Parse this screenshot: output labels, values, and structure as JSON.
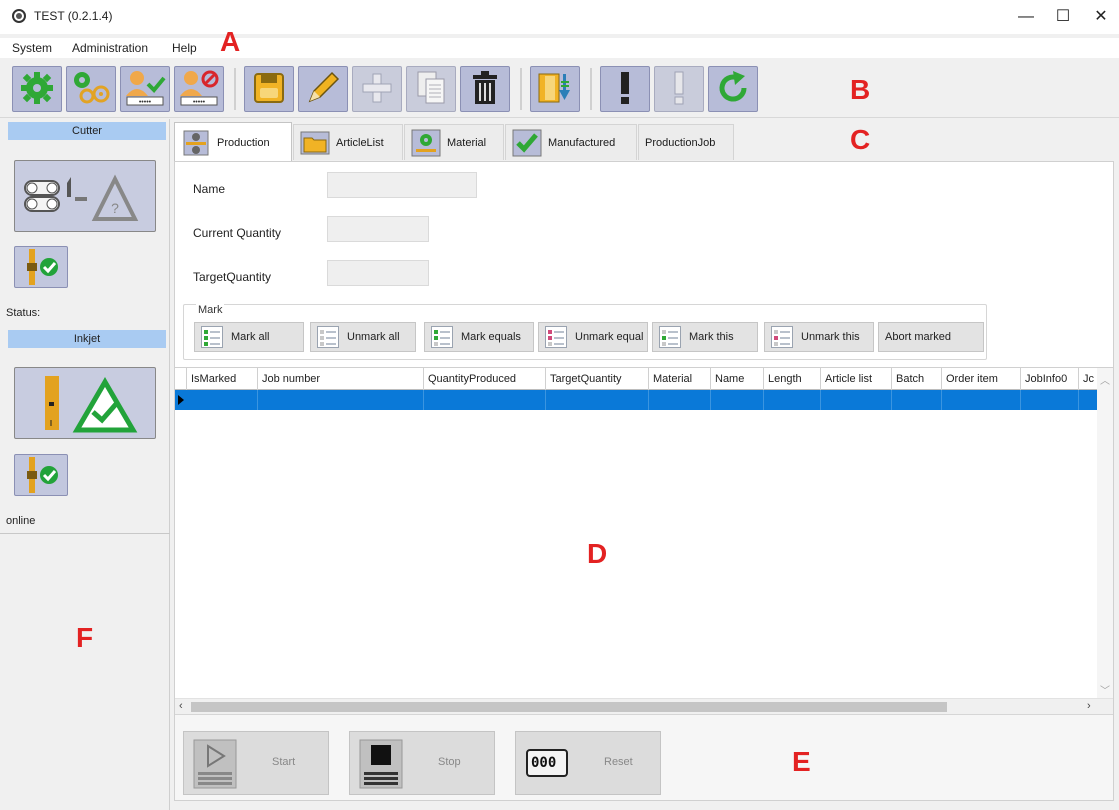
{
  "window": {
    "title": "TEST (0.2.1.4)",
    "controls": {
      "minimize": "—",
      "maximize": "☐",
      "close": "✕"
    }
  },
  "menu": {
    "items": [
      "System",
      "Administration",
      "Help"
    ]
  },
  "annotations": {
    "a": "A",
    "b": "B",
    "c": "C",
    "d": "D",
    "e": "E",
    "f": "F"
  },
  "toolbar": {
    "buttons": [
      {
        "icon": "gear-icon",
        "enabled": true
      },
      {
        "icon": "gears-icon",
        "enabled": true
      },
      {
        "icon": "user-check-icon",
        "enabled": true
      },
      {
        "icon": "user-block-icon",
        "enabled": true
      },
      {
        "icon": "save-icon",
        "enabled": true
      },
      {
        "icon": "pencil-icon",
        "enabled": true
      },
      {
        "icon": "plus-icon",
        "enabled": false
      },
      {
        "icon": "copy-icon",
        "enabled": false
      },
      {
        "icon": "trash-icon",
        "enabled": true
      },
      {
        "icon": "import-icon",
        "enabled": true
      },
      {
        "icon": "exclamation-icon",
        "enabled": true
      },
      {
        "icon": "exclamation-disabled-icon",
        "enabled": false
      },
      {
        "icon": "refresh-icon",
        "enabled": true
      }
    ]
  },
  "left_panel": {
    "cutter": {
      "header": "Cutter",
      "status_label": "Status:"
    },
    "inkjet": {
      "header": "Inkjet",
      "status_label": "online"
    }
  },
  "tabs": [
    {
      "label": "Production",
      "icon": "production-icon",
      "active": true
    },
    {
      "label": "ArticleList",
      "icon": "folder-icon",
      "active": false
    },
    {
      "label": "Material",
      "icon": "material-icon",
      "active": false
    },
    {
      "label": "Manufactured",
      "icon": "check-icon",
      "active": false
    },
    {
      "label": "ProductionJob",
      "icon": "",
      "active": false
    }
  ],
  "form": {
    "name_label": "Name",
    "current_quantity_label": "Current Quantity",
    "target_quantity_label": "TargetQuantity",
    "name_value": "",
    "current_quantity_value": "",
    "target_quantity_value": ""
  },
  "mark": {
    "title": "Mark",
    "buttons": [
      "Mark all",
      "Unmark all",
      "Mark equals",
      "Unmark equal",
      "Mark this",
      "Unmark this",
      "Abort marked"
    ]
  },
  "grid": {
    "columns": [
      "IsMarked",
      "Job number",
      "QuantityProduced",
      "TargetQuantity",
      "Material",
      "Name",
      "Length",
      "Article list",
      "Batch",
      "Order item",
      "JobInfo0",
      "Jc"
    ],
    "rows": [
      [
        "",
        "",
        "",
        "",
        "",
        "",
        "",
        "",
        "",
        "",
        "",
        ""
      ]
    ],
    "selection_color": "#0a79d8"
  },
  "bottom_buttons": {
    "start": "Start",
    "stop": "Stop",
    "reset": "Reset",
    "reset_glyph": "000"
  },
  "colors": {
    "toolbar_button": "#b7bcd8",
    "panel_header": "#a9cbf2",
    "annotation": "#e32222",
    "status_ok": "#22a33a"
  }
}
